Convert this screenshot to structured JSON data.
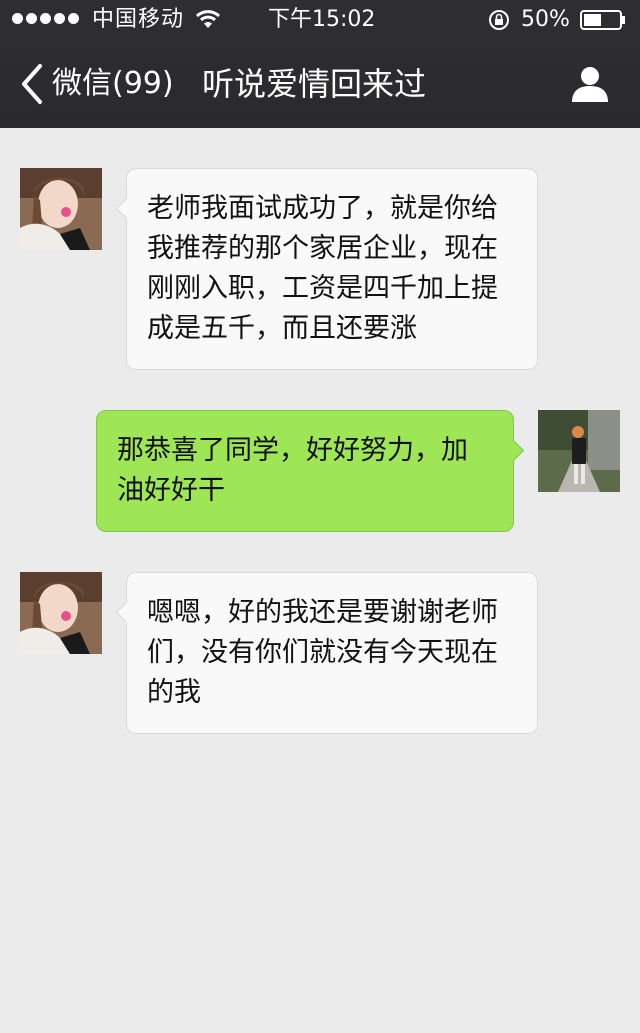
{
  "status_bar": {
    "carrier": "中国移动",
    "time": "下午15:02",
    "battery_percent": "50%",
    "battery_level": 0.5,
    "signal_dots": 5
  },
  "nav": {
    "back_label": "微信(99)",
    "title": "听说爱情回来过"
  },
  "messages": [
    {
      "direction": "incoming",
      "text": "老师我面试成功了，就是你给我推荐的那个家居企业，现在刚刚入职，工资是四千加上提成是五千，而且还要涨"
    },
    {
      "direction": "outgoing",
      "text": "那恭喜了同学，好好努力，加油好好干"
    },
    {
      "direction": "incoming",
      "text": "嗯嗯，好的我还是要谢谢老师们，没有你们就没有今天现在的我"
    }
  ],
  "colors": {
    "header_bg": "#2d2d31",
    "chat_bg": "#ebebeb",
    "incoming_bubble": "#f9f9f9",
    "outgoing_bubble": "#9ee656"
  }
}
